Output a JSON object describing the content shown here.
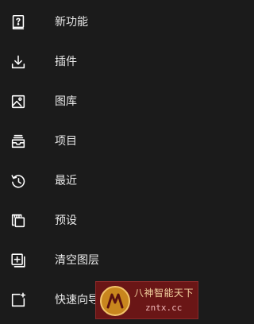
{
  "menu": {
    "items": [
      {
        "label": "新功能",
        "icon": "question-book-icon"
      },
      {
        "label": "插件",
        "icon": "download-icon"
      },
      {
        "label": "图库",
        "icon": "image-icon"
      },
      {
        "label": "项目",
        "icon": "inbox-stack-icon"
      },
      {
        "label": "最近",
        "icon": "history-clock-icon"
      },
      {
        "label": "预设",
        "icon": "presets-stack-icon"
      },
      {
        "label": "清空图层",
        "icon": "add-layer-icon"
      },
      {
        "label": "快速向导",
        "icon": "new-canvas-icon"
      }
    ]
  },
  "watermark": {
    "title": "八神智能天下",
    "domain": "zntx.cc",
    "colors": {
      "background": "#6a1616",
      "text": "#f3d2a0"
    }
  },
  "colors": {
    "background": "#1b1b1b",
    "text": "#e9e9e9",
    "icon": "#ffffff"
  }
}
